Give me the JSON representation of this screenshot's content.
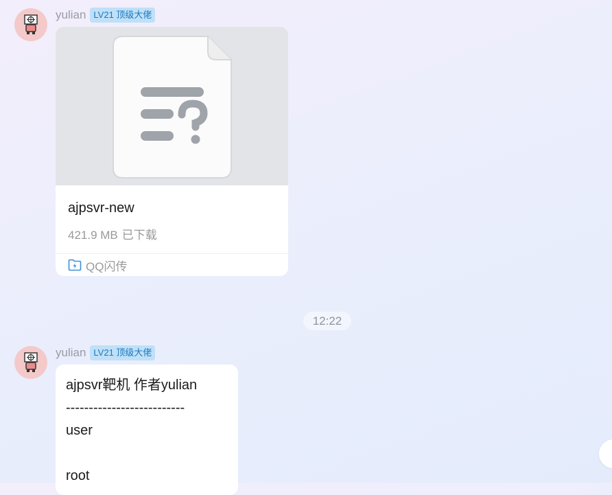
{
  "messages": [
    {
      "sender": "yulian",
      "badge": "LV21 顶级大佬",
      "avatar_icon": "pixel-character-avatar-icon",
      "file": {
        "icon": "unknown-file-icon",
        "name": "ajpsvr-new",
        "size": "421.9 MB",
        "status": "已下载",
        "source_icon": "flash-transfer-icon",
        "source": "QQ闪传"
      }
    },
    {
      "sender": "yulian",
      "badge": "LV21 顶级大佬",
      "avatar_icon": "pixel-character-avatar-icon",
      "text_lines": [
        "ajpsvr靶机  作者yulian",
        "--------------------------",
        "user",
        "",
        "root"
      ]
    }
  ],
  "time_divider": "12:22",
  "colors": {
    "badge_bg": "#bfe0f7",
    "badge_text": "#1a78c2",
    "avatar_bg": "#f4c9c9"
  }
}
